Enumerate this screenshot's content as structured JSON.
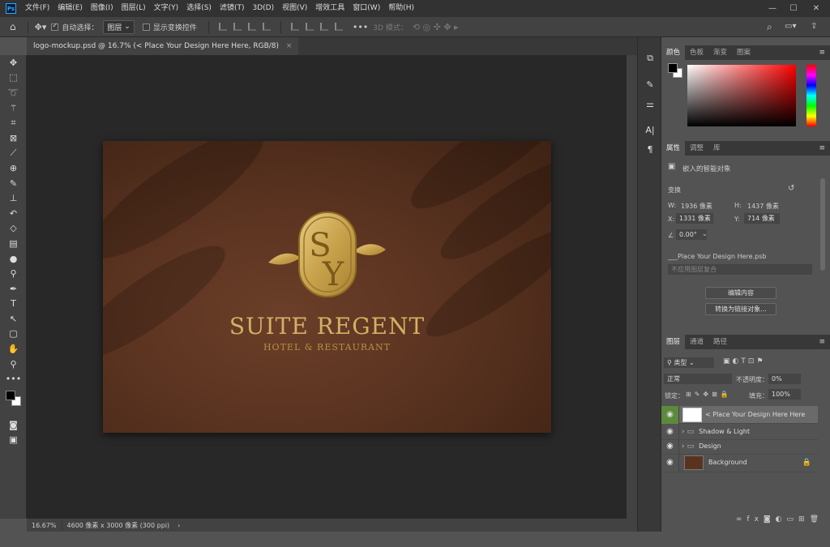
{
  "app": {
    "logo_text": "Ps"
  },
  "menubar": {
    "items": [
      "文件(F)",
      "编辑(E)",
      "图像(I)",
      "图层(L)",
      "文字(Y)",
      "选择(S)",
      "滤镜(T)",
      "3D(D)",
      "视图(V)",
      "增效工具",
      "窗口(W)",
      "帮助(H)"
    ]
  },
  "window_controls": {
    "minimize": "—",
    "maximize": "☐",
    "close": "✕"
  },
  "options_bar": {
    "auto_select_label": "自动选择：",
    "auto_select_value": "图层",
    "show_transform_label": "显示变换控件",
    "mode_3d_label": "3D 模式："
  },
  "document": {
    "tab_title": "logo-mockup.psd @ 16.7% (< Place Your Design Here Here, RGB/8)",
    "tab_close": "×",
    "zoom": "16.67%",
    "doc_info": "4600 像素 x 3000 像素 (300 ppi)"
  },
  "mockup": {
    "monogram_top": "S",
    "monogram_bottom": "Y",
    "brand_name": "SUITE REGENT",
    "brand_sub": "HOTEL & RESTAURANT"
  },
  "color_panel": {
    "tabs": [
      "颜色",
      "色板",
      "渐变",
      "图案"
    ],
    "accent_gradient_hue": "#ff0000"
  },
  "properties_panel": {
    "tabs": [
      "属性",
      "调整",
      "库"
    ],
    "object_type": "嵌入的智能对象",
    "transform_label": "变换",
    "w_label": "W:",
    "w_value": "1936 像素",
    "h_label": "H:",
    "h_value": "1437 像素",
    "x_label": "X:",
    "x_value": "1331 像素",
    "y_label": "Y:",
    "y_value": "714 像素",
    "angle_value": "0.00°",
    "smart_file": "___Place Your Design Here.psb",
    "layer_comp_placeholder": "不应用图层复合",
    "edit_contents_button": "编辑内容",
    "convert_linked_button": "转换为链接对象..."
  },
  "layers_panel": {
    "tabs": [
      "图层",
      "通道",
      "路径"
    ],
    "filter_kind": "类型",
    "blend_mode": "正常",
    "opacity_label": "不透明度：",
    "opacity_value": "0%",
    "lock_label": "锁定：",
    "fill_label": "填充：",
    "fill_value": "100%",
    "layers": [
      {
        "name": "< Place Your Design Here Here",
        "type": "smart",
        "selected": true
      },
      {
        "name": "Shadow & Light",
        "type": "group",
        "selected": false
      },
      {
        "name": "Design",
        "type": "group",
        "selected": false
      },
      {
        "name": "Background",
        "type": "image",
        "selected": false,
        "locked": true
      }
    ]
  },
  "colors": {
    "ui_dark": "#323232",
    "ui_mid": "#424242",
    "panel": "#535353",
    "canvas_bg": "#282828",
    "leather": "#5a3320",
    "gold": "#d4b063",
    "selected_eye": "#5b8a3c"
  }
}
